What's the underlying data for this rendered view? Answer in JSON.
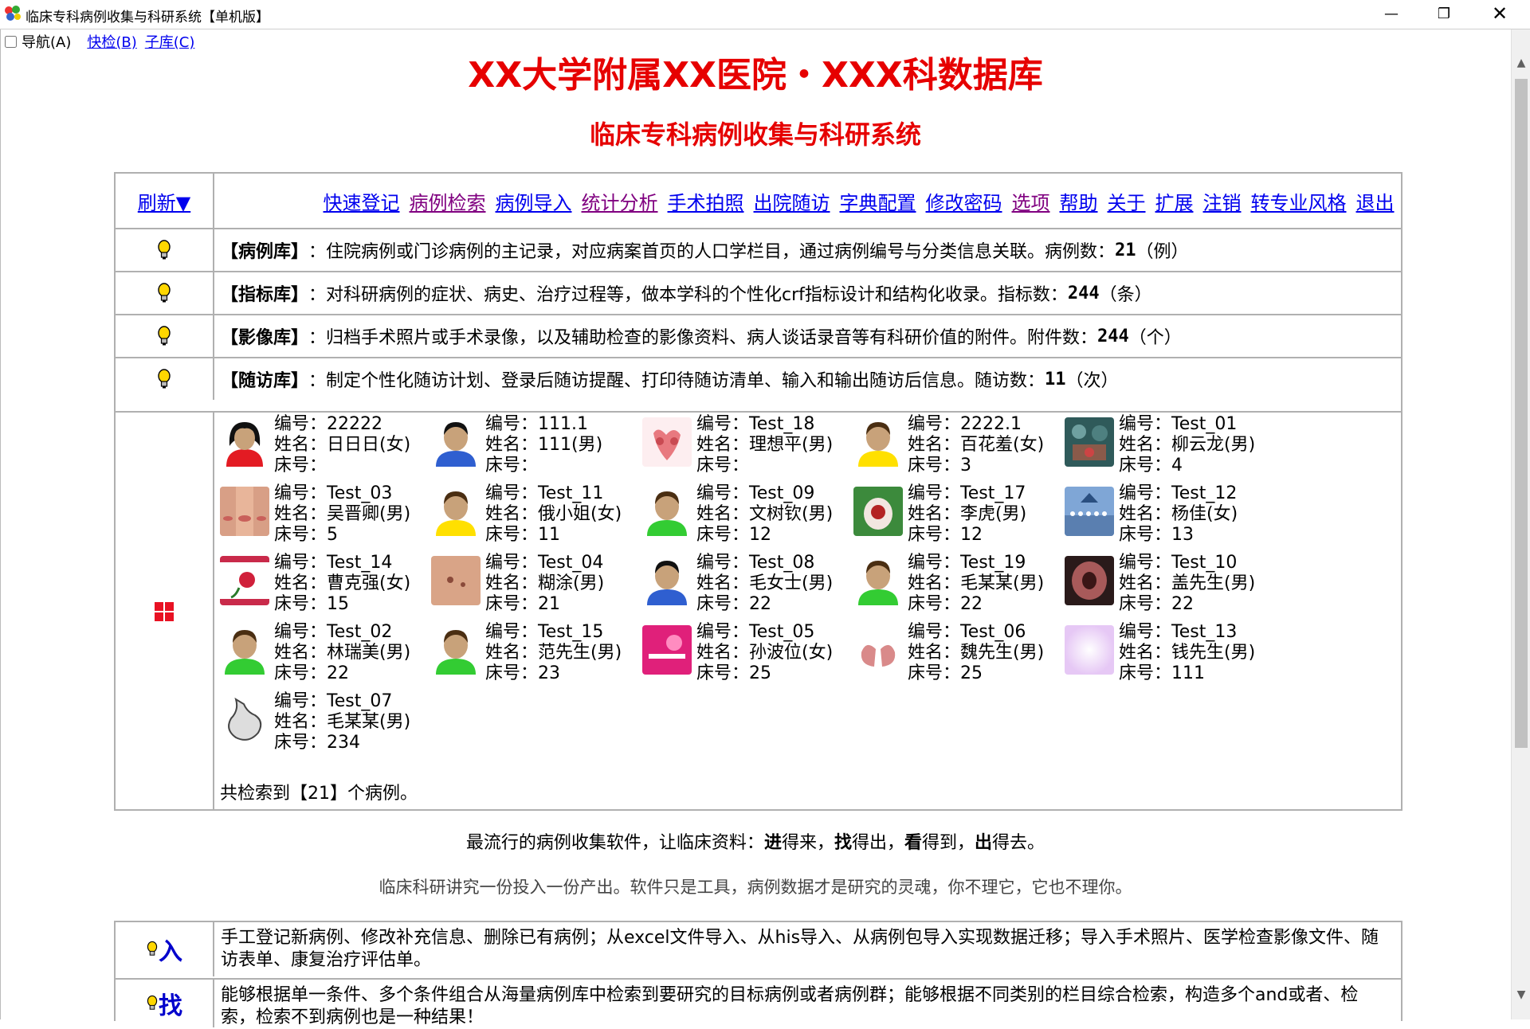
{
  "window": {
    "title": "临床专科病例收集与科研系统【单机版】",
    "min_glyph": "—",
    "max_glyph": "❐",
    "close_glyph": "✕"
  },
  "topnav": {
    "nav_label": "导航(A)",
    "quick_check": "快检(B)",
    "sub_db": "子库(C)"
  },
  "header": {
    "title": "XX大学附属XX医院・XXX科数据库",
    "subtitle": "临床专科病例收集与科研系统"
  },
  "menu": {
    "refresh": "刷新▼",
    "items": [
      {
        "label": "快速登记",
        "visited": false
      },
      {
        "label": "病例检索",
        "visited": true
      },
      {
        "label": "病例导入",
        "visited": false
      },
      {
        "label": "统计分析",
        "visited": true
      },
      {
        "label": "手术拍照",
        "visited": false
      },
      {
        "label": "出院随访",
        "visited": false
      },
      {
        "label": "字典配置",
        "visited": false
      },
      {
        "label": "修改密码",
        "visited": false
      },
      {
        "label": "选项",
        "visited": true
      },
      {
        "label": "帮助",
        "visited": false
      },
      {
        "label": "关于",
        "visited": false
      },
      {
        "label": "扩展",
        "visited": false
      },
      {
        "label": "注销",
        "visited": false
      },
      {
        "label": "转专业风格",
        "visited": false
      },
      {
        "label": "退出",
        "visited": false
      }
    ]
  },
  "libraries": [
    {
      "name": "【病例库】",
      "sep": "：",
      "desc": "住院病例或门诊病例的主记录，对应病案首页的人口学栏目，通过病例编号与分类信息关联。病例数：",
      "count": "21",
      "unit": "（例）"
    },
    {
      "name": "【指标库】",
      "sep": "：",
      "desc": "对科研病例的症状、病史、治疗过程等，做本学科的个性化crf指标设计和结构化收录。指标数：",
      "count": "244",
      "unit": "（条）"
    },
    {
      "name": "【影像库】",
      "sep": "：",
      "desc": "归档手术照片或手术录像，以及辅助检查的影像资料、病人谈话录音等有科研价值的附件。附件数：",
      "count": "244",
      "unit": "（个）"
    },
    {
      "name": "【随访库】",
      "sep": "：",
      "desc": "制定个性化随访计划、登录后随访提醒、打印待随访清单、输入和输出随访后信息。随访数：",
      "count": "11",
      "unit": "（次）"
    }
  ],
  "labels": {
    "id": "编号：",
    "name": "姓名：",
    "bed": "床号："
  },
  "cases": [
    {
      "id": "22222",
      "name": "日日日(女)",
      "bed": "",
      "thumb": "avatar-female"
    },
    {
      "id": "111.1",
      "name": "111(男)",
      "bed": "",
      "thumb": "avatar-male-blue"
    },
    {
      "id": "Test_18",
      "name": "理想平(男)",
      "bed": "",
      "thumb": "anatomy"
    },
    {
      "id": "2222.1",
      "name": "百花羞(女)",
      "bed": "3",
      "thumb": "avatar-yellow"
    },
    {
      "id": "Test_01",
      "name": "柳云龙(男)",
      "bed": "4",
      "thumb": "surgery"
    },
    {
      "id": "Test_03",
      "name": "吴晋卿(男)",
      "bed": "5",
      "thumb": "face-photo"
    },
    {
      "id": "Test_11",
      "name": "俄小姐(女)",
      "bed": "11",
      "thumb": "avatar-yellow"
    },
    {
      "id": "Test_09",
      "name": "文树钦(男)",
      "bed": "12",
      "thumb": "avatar-green"
    },
    {
      "id": "Test_17",
      "name": "李虎(男)",
      "bed": "12",
      "thumb": "wound"
    },
    {
      "id": "Test_12",
      "name": "杨佳(女)",
      "bed": "13",
      "thumb": "group-photo"
    },
    {
      "id": "Test_14",
      "name": "曹克强(女)",
      "bed": "15",
      "thumb": "rose"
    },
    {
      "id": "Test_04",
      "name": "糊涂(男)",
      "bed": "21",
      "thumb": "skin"
    },
    {
      "id": "Test_08",
      "name": "毛女士(男)",
      "bed": "22",
      "thumb": "avatar-male-blue"
    },
    {
      "id": "Test_19",
      "name": "毛某某(男)",
      "bed": "22",
      "thumb": "avatar-green"
    },
    {
      "id": "Test_10",
      "name": "盖先生(男)",
      "bed": "22",
      "thumb": "endoscopy"
    },
    {
      "id": "Test_02",
      "name": "林瑞美(男)",
      "bed": "22",
      "thumb": "avatar-green"
    },
    {
      "id": "Test_15",
      "name": "范先生(男)",
      "bed": "23",
      "thumb": "avatar-green"
    },
    {
      "id": "Test_05",
      "name": "孙波位(女)",
      "bed": "25",
      "thumb": "pink-card"
    },
    {
      "id": "Test_06",
      "name": "魏先生(男)",
      "bed": "25",
      "thumb": "lungs"
    },
    {
      "id": "Test_13",
      "name": "钱先生(男)",
      "bed": "111",
      "thumb": "lavender"
    },
    {
      "id": "Test_07",
      "name": "毛某某(男)",
      "bed": "234",
      "thumb": "stomach"
    }
  ],
  "total": {
    "prefix": "共检索到【",
    "count": "21",
    "suffix": "】个病例。"
  },
  "taglines": {
    "t1_a": "最流行的病例收集软件，让临床资料：",
    "t1_b1": "进",
    "t1_c1": "得来，",
    "t1_b2": "找",
    "t1_c2": "得出，",
    "t1_b3": "看",
    "t1_c3": "得到，",
    "t1_b4": "出",
    "t1_c4": "得去。",
    "t2": "临床科研讲究一份投入一份产出。软件只是工具，病例数据才是研究的灵魂，你不理它，它也不理你。"
  },
  "features": [
    {
      "key": "入",
      "text": "手工登记新病例、修改补充信息、删除已有病例；从excel文件导入、从his导入、从病例包导入实现数据迁移；导入手术照片、医学检查影像文件、随访表单、康复治疗评估单。"
    },
    {
      "key": "找",
      "text": "能够根据单一条件、多个条件组合从海量病例库中检索到要研究的目标病例或者病例群；能够根据不同类别的栏目综合检索，构造多个and或者、检索，检索不到病例也是一种结果！"
    }
  ],
  "colors": {
    "title_red": "#e60000",
    "link_blue": "#0000ee",
    "link_visited": "#800080",
    "feature_blue": "#0000cc"
  }
}
